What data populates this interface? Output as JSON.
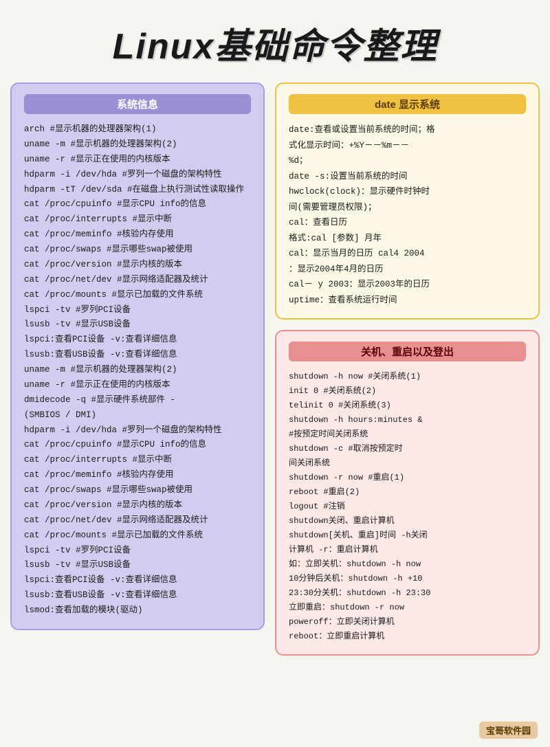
{
  "title": "Linux基础命令整理",
  "sysinfo": {
    "title": "系统信息",
    "lines": [
      "arch        #显示机器的处理器架构(1)",
      "uname -m  #显示机器的处理器架构(2)",
      "uname -r  #显示正在使用的内核版本",
      "hdparm -i /dev/hda    #罗列一个磁盘的架构特性",
      "hdparm -tT /dev/sda  #在磁盘上执行测试性读取操作",
      "cat /proc/cpuinfo     #显示CPU info的信息",
      "cat /proc/interrupts  #显示中断",
      "cat /proc/meminfo     #核验内存使用",
      "cat /proc/swaps       #显示哪些swap被使用",
      "cat /proc/version     #显示内核的版本",
      "cat /proc/net/dev     #显示网络适配器及统计",
      "cat /proc/mounts      #显示已加载的文件系统",
      "lspci -tv    #罗列PCI设备",
      "lsusb -tv   #显示USB设备",
      "lspci:查看PCI设备 -v:查看详细信息",
      "lsusb:查看USB设备 -v:查看详细信息",
      "uname -m  #显示机器的处理器架构(2)",
      "uname -r  #显示正在使用的内核版本",
      "dmidecode -q          #显示硬件系统部件 -",
      "(SMBIOS / DMI)",
      "hdparm -i /dev/hda    #罗列一个磁盘的架构特性",
      "cat /proc/cpuinfo     #显示CPU info的信息",
      "cat /proc/interrupts  #显示中断",
      "cat /proc/meminfo     #核验内存使用",
      "cat /proc/swaps       #显示哪些swap被使用",
      "cat /proc/version     #显示内核的版本",
      "cat /proc/net/dev     #显示网络适配器及统计",
      "cat /proc/mounts      #显示已加载的文件系统",
      "lspci -tv   #罗列PCI设备",
      "lsusb -tv   #显示USB设备",
      "lspci:查看PCI设备 -v:查看详细信息",
      "lsusb:查看USB设备 -v:查看详细信息",
      "lsmod:查看加载的模块(驱动)"
    ]
  },
  "date": {
    "title": "date 显示系统",
    "lines": [
      "date:查看或设置当前系统的时间；格",
      "式化显示时间：+%Y－－%m－－",
      "%d；",
      "date -s:设置当前系统的时间",
      "hwclock(clock)：显示硬件时钟时",
      "间(需要管理员权限)；",
      "cal：查看日历",
      "格式:cal [参数] 月年",
      "cal：显示当月的日历   cal4 2004",
      "：显示2004年4月的日历",
      "cal－ y 2003：显示2003年的日历",
      "uptime：查看系统运行时间"
    ]
  },
  "shutdown": {
    "title": "关机、重启以及登出",
    "lines": [
      "shutdown -h now    #关闭系统(1)",
      "init 0              #关闭系统(2)",
      "telinit 0           #关闭系统(3)",
      "shutdown -h hours:minutes &",
      "  #按预定时间关闭系统",
      "shutdown -c         #取消按预定时",
      "间关闭系统",
      "shutdown -r now   #重启(1)",
      "reboot    #重启(2)",
      "logout    #注销",
      "shutdown关闭、重启计算机",
      "shutdown[关机、重启]时间  -h关闭",
      "计算机    -r：重启计算机",
      "如：立即关机：shutdown -h now",
      "10分钟后关机：shutdown -h +10",
      "23:30分关机：shutdown -h 23:30",
      "立即重启：shutdown -r now",
      "poweroff：立即关闭计算机",
      "reboot：立即重启计算机"
    ]
  },
  "watermark": "宝哥软件园"
}
